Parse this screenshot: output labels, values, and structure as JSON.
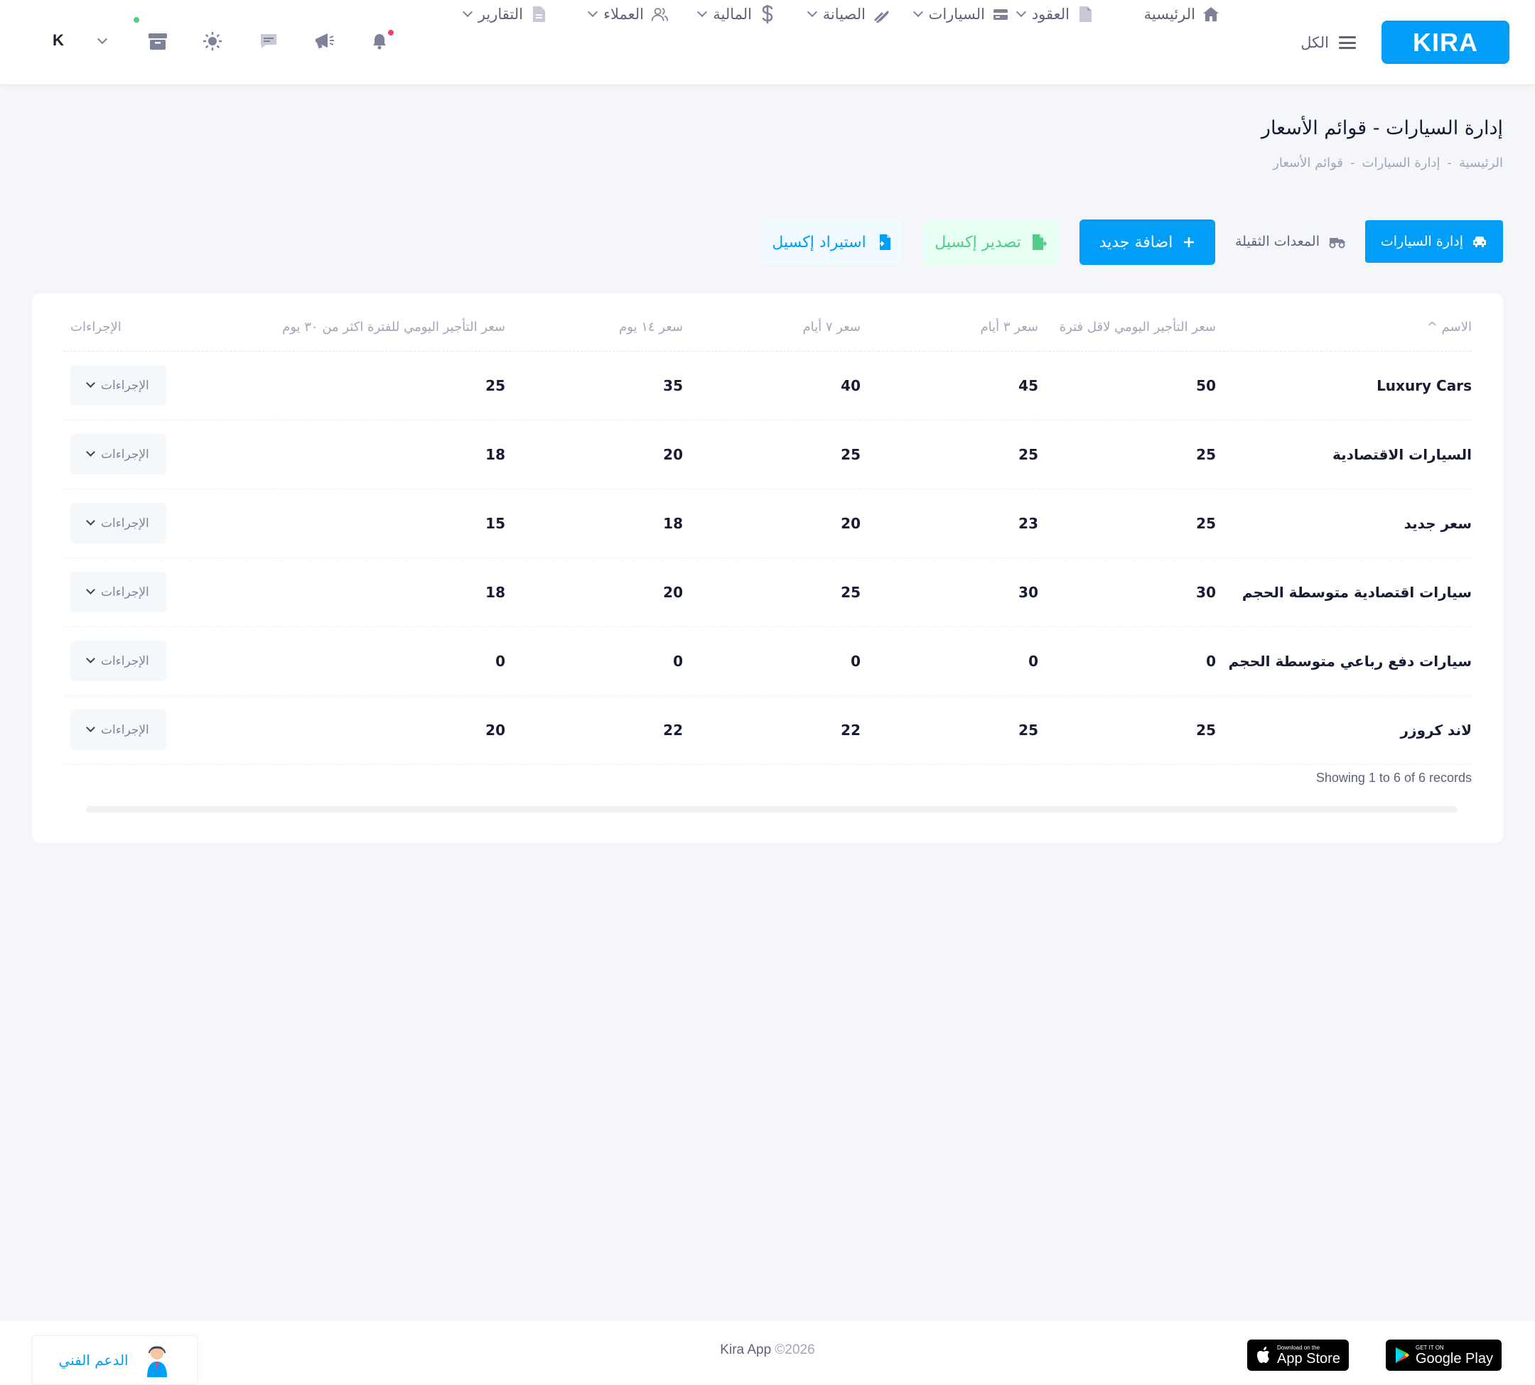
{
  "header": {
    "logo_text": "KIRA",
    "all_label": "الكل",
    "nav": [
      {
        "label": "الرئيسية",
        "icon": "home-icon"
      },
      {
        "label": "العقود",
        "icon": "document-icon"
      },
      {
        "label": "السيارات",
        "icon": "car-card-icon"
      },
      {
        "label": "الصيانة",
        "icon": "wrench-icon"
      },
      {
        "label": "المالية",
        "icon": "dollar-icon"
      },
      {
        "label": "العملاء",
        "icon": "users-icon"
      },
      {
        "label": "التقارير",
        "icon": "report-icon"
      }
    ],
    "user_initial": "K"
  },
  "page": {
    "title": "إدارة السيارات - قوائم الأسعار",
    "breadcrumb": [
      "الرئيسية",
      "-",
      "إدارة السيارات",
      "-",
      "قوائم الأسعار"
    ]
  },
  "toolbar": {
    "tab_cars": "إدارة السيارات",
    "tab_heavy": "المعدات الثقيلة",
    "add_label": "اضافة جديد",
    "export_label": "تصدير إكسيل",
    "import_label": "استيراد إكسيل"
  },
  "table": {
    "headers": [
      "الاسم",
      "سعر التأجير اليومي لاقل فترة",
      "سعر ٣ أيام",
      "سعر ٧ أيام",
      "سعر ١٤ يوم",
      "سعر التأجير اليومي للفترة اكثر من ٣٠ يوم",
      "الإجراءات"
    ],
    "rows": [
      {
        "name": "Luxury Cars",
        "min": "50",
        "d3": "45",
        "d7": "40",
        "d14": "35",
        "d30": "25",
        "action": "الإجراءات"
      },
      {
        "name": "السيارات الاقتصادية",
        "min": "25",
        "d3": "25",
        "d7": "25",
        "d14": "20",
        "d30": "18",
        "action": "الإجراءات"
      },
      {
        "name": "سعر جديد",
        "min": "25",
        "d3": "23",
        "d7": "20",
        "d14": "18",
        "d30": "15",
        "action": "الإجراءات"
      },
      {
        "name": "سيارات اقتصادية متوسطة الحجم",
        "min": "30",
        "d3": "30",
        "d7": "25",
        "d14": "20",
        "d30": "18",
        "action": "الإجراءات"
      },
      {
        "name": "سيارات دفع رباعي متوسطة الحجم",
        "min": "0",
        "d3": "0",
        "d7": "0",
        "d14": "0",
        "d30": "0",
        "action": "الإجراءات"
      },
      {
        "name": "لاند كروزر",
        "min": "25",
        "d3": "25",
        "d7": "22",
        "d14": "22",
        "d30": "20",
        "action": "الإجراءات"
      }
    ],
    "records_text": "Showing 1 to 6 of 6 records"
  },
  "footer": {
    "support_label": "الدعم الفني",
    "year": "©2026",
    "app_name": "Kira App",
    "appstore_small": "Download on the",
    "appstore_big": "App Store",
    "googleplay_small": "GET IT ON",
    "googleplay_big": "Google Play"
  },
  "colors": {
    "primary": "#009ef7",
    "success": "#50cd89",
    "notification_dot": "#f1416c",
    "online_dot": "#50cd89"
  }
}
